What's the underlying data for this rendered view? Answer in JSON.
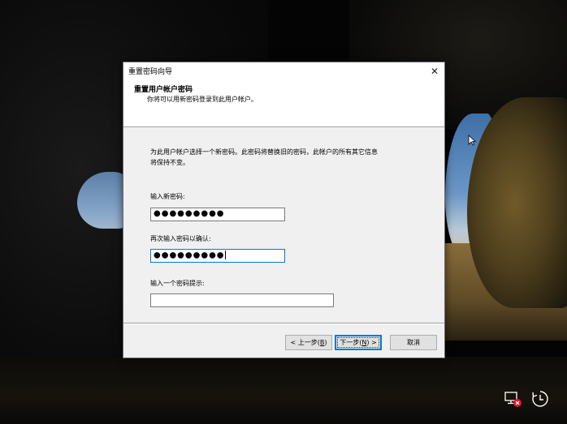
{
  "window": {
    "title": "重置密码向导",
    "close_glyph": "✕"
  },
  "header": {
    "title": "重置用户帐户密码",
    "subtitle": "你将可以用新密码登录到此用户帐户。"
  },
  "content": {
    "description_line1": "为此用户帐户选择一个新密码。此密码将替换旧的密码，此帐户的所有其它信息",
    "description_line2": "将保持不变。",
    "new_password_label": "输入新密码:",
    "new_password_value": "●●●●●●●●●",
    "confirm_password_label": "再次输入密码以确认:",
    "confirm_password_value": "●●●●●●●●●",
    "hint_label": "输入一个密码提示:",
    "hint_value": ""
  },
  "buttons": {
    "back_label_pre": "< 上一步(",
    "back_mnemonic": "B",
    "back_label_post": ")",
    "next_label_pre": "下一步(",
    "next_mnemonic": "N",
    "next_label_post": ") >",
    "cancel_label": "取消"
  },
  "tray": {
    "network_icon": "network-disconnected-icon",
    "ease_of_access_icon": "ease-of-access-icon"
  },
  "colors": {
    "accent": "#0078d7",
    "dialog_bg": "#f0f0f0",
    "header_bg": "#ffffff",
    "error_red": "#e81123"
  }
}
